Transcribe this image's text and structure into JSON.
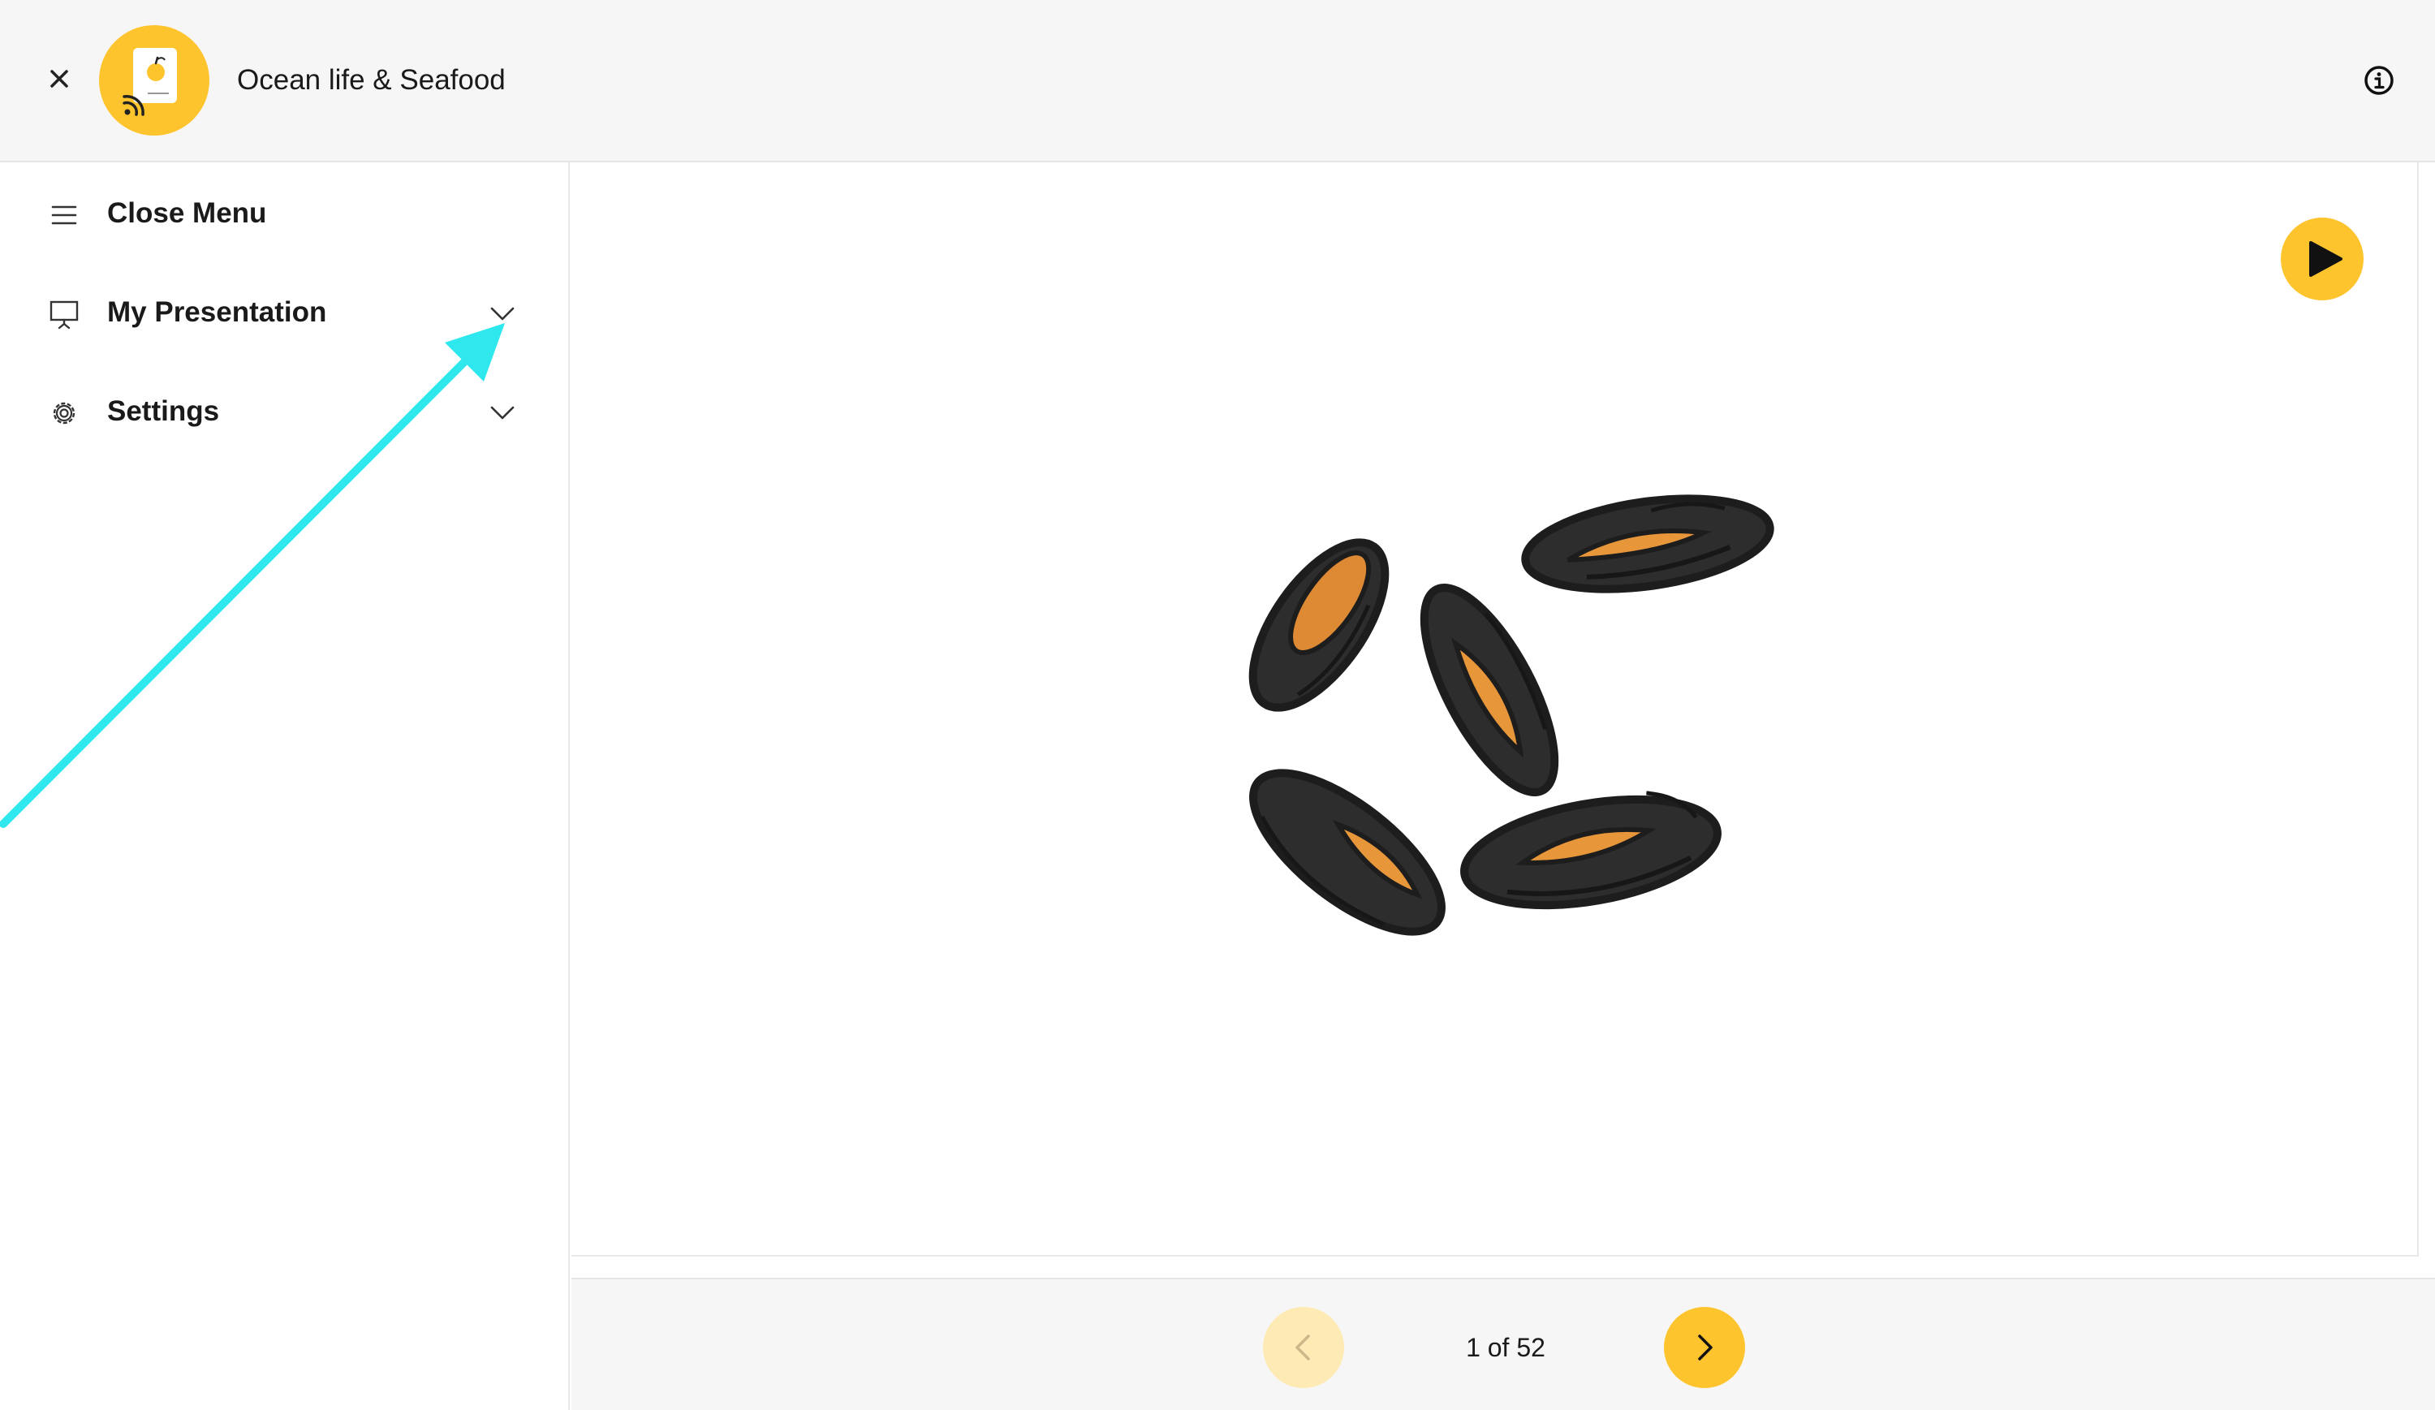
{
  "header": {
    "title": "Ocean life & Seafood",
    "close_icon": "close-icon",
    "logo_icon": "app-logo-icon",
    "info_icon": "info-icon"
  },
  "sidebar": {
    "items": [
      {
        "label": "Close Menu",
        "icon": "hamburger-menu-icon"
      },
      {
        "label": "My Presentation",
        "icon": "presentation-screen-icon",
        "expandable": true
      },
      {
        "label": "Settings",
        "icon": "gear-icon",
        "expandable": true
      }
    ]
  },
  "slide": {
    "image": "mussels-illustration",
    "play_icon": "play-icon"
  },
  "pagination": {
    "current": 1,
    "total": 52,
    "label": "1 of 52",
    "prev_icon": "chevron-left-icon",
    "next_icon": "chevron-right-icon"
  },
  "colors": {
    "accent": "#fec42d",
    "accent_disabled": "#fdeab5",
    "annotation_arrow": "#2ee8ee",
    "mussel_shell": "#2e2d2d",
    "mussel_flesh": "#e8963a"
  }
}
